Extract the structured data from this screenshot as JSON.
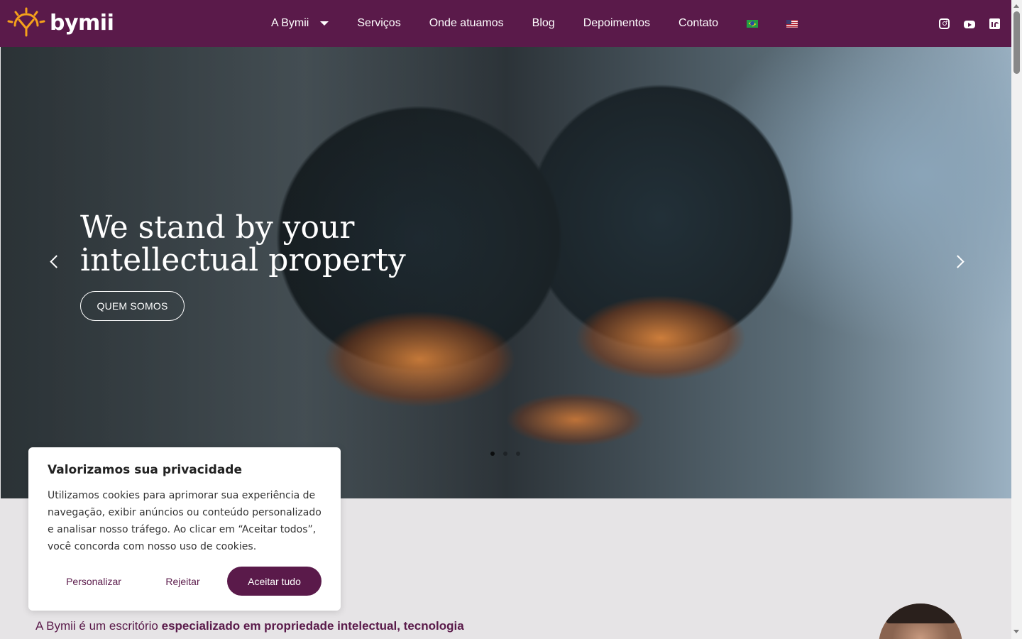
{
  "header": {
    "logo_text": "bymii",
    "brand_color": "#5a1a4a",
    "accent_color": "#f5a11b",
    "nav": [
      {
        "label": "A Bymii",
        "has_dropdown": true
      },
      {
        "label": "Serviços"
      },
      {
        "label": "Onde atuamos"
      },
      {
        "label": "Blog"
      },
      {
        "label": "Depoimentos"
      },
      {
        "label": "Contato"
      }
    ],
    "languages": [
      "brazil-flag-icon",
      "us-flag-icon"
    ],
    "social": [
      "instagram-icon",
      "youtube-icon",
      "linkedin-icon"
    ]
  },
  "hero": {
    "title": "We stand by your intellectual property",
    "button": "QUEM SOMOS",
    "slides_count": 3,
    "active_slide": 1
  },
  "intro": {
    "text_plain": "A Bymii é um escritório ",
    "text_bold": "especializado em propriedade intelectual, tecnologia"
  },
  "cookie": {
    "title": "Valorizamos sua privacidade",
    "text": "Utilizamos cookies para aprimorar sua experiência de navegação, exibir anúncios ou conteúdo personalizado e analisar nosso tráfego. Ao clicar em “Aceitar todos”, você concorda com nosso uso de cookies.",
    "customize": "Personalizar",
    "reject": "Rejeitar",
    "accept": "Aceitar tudo"
  }
}
